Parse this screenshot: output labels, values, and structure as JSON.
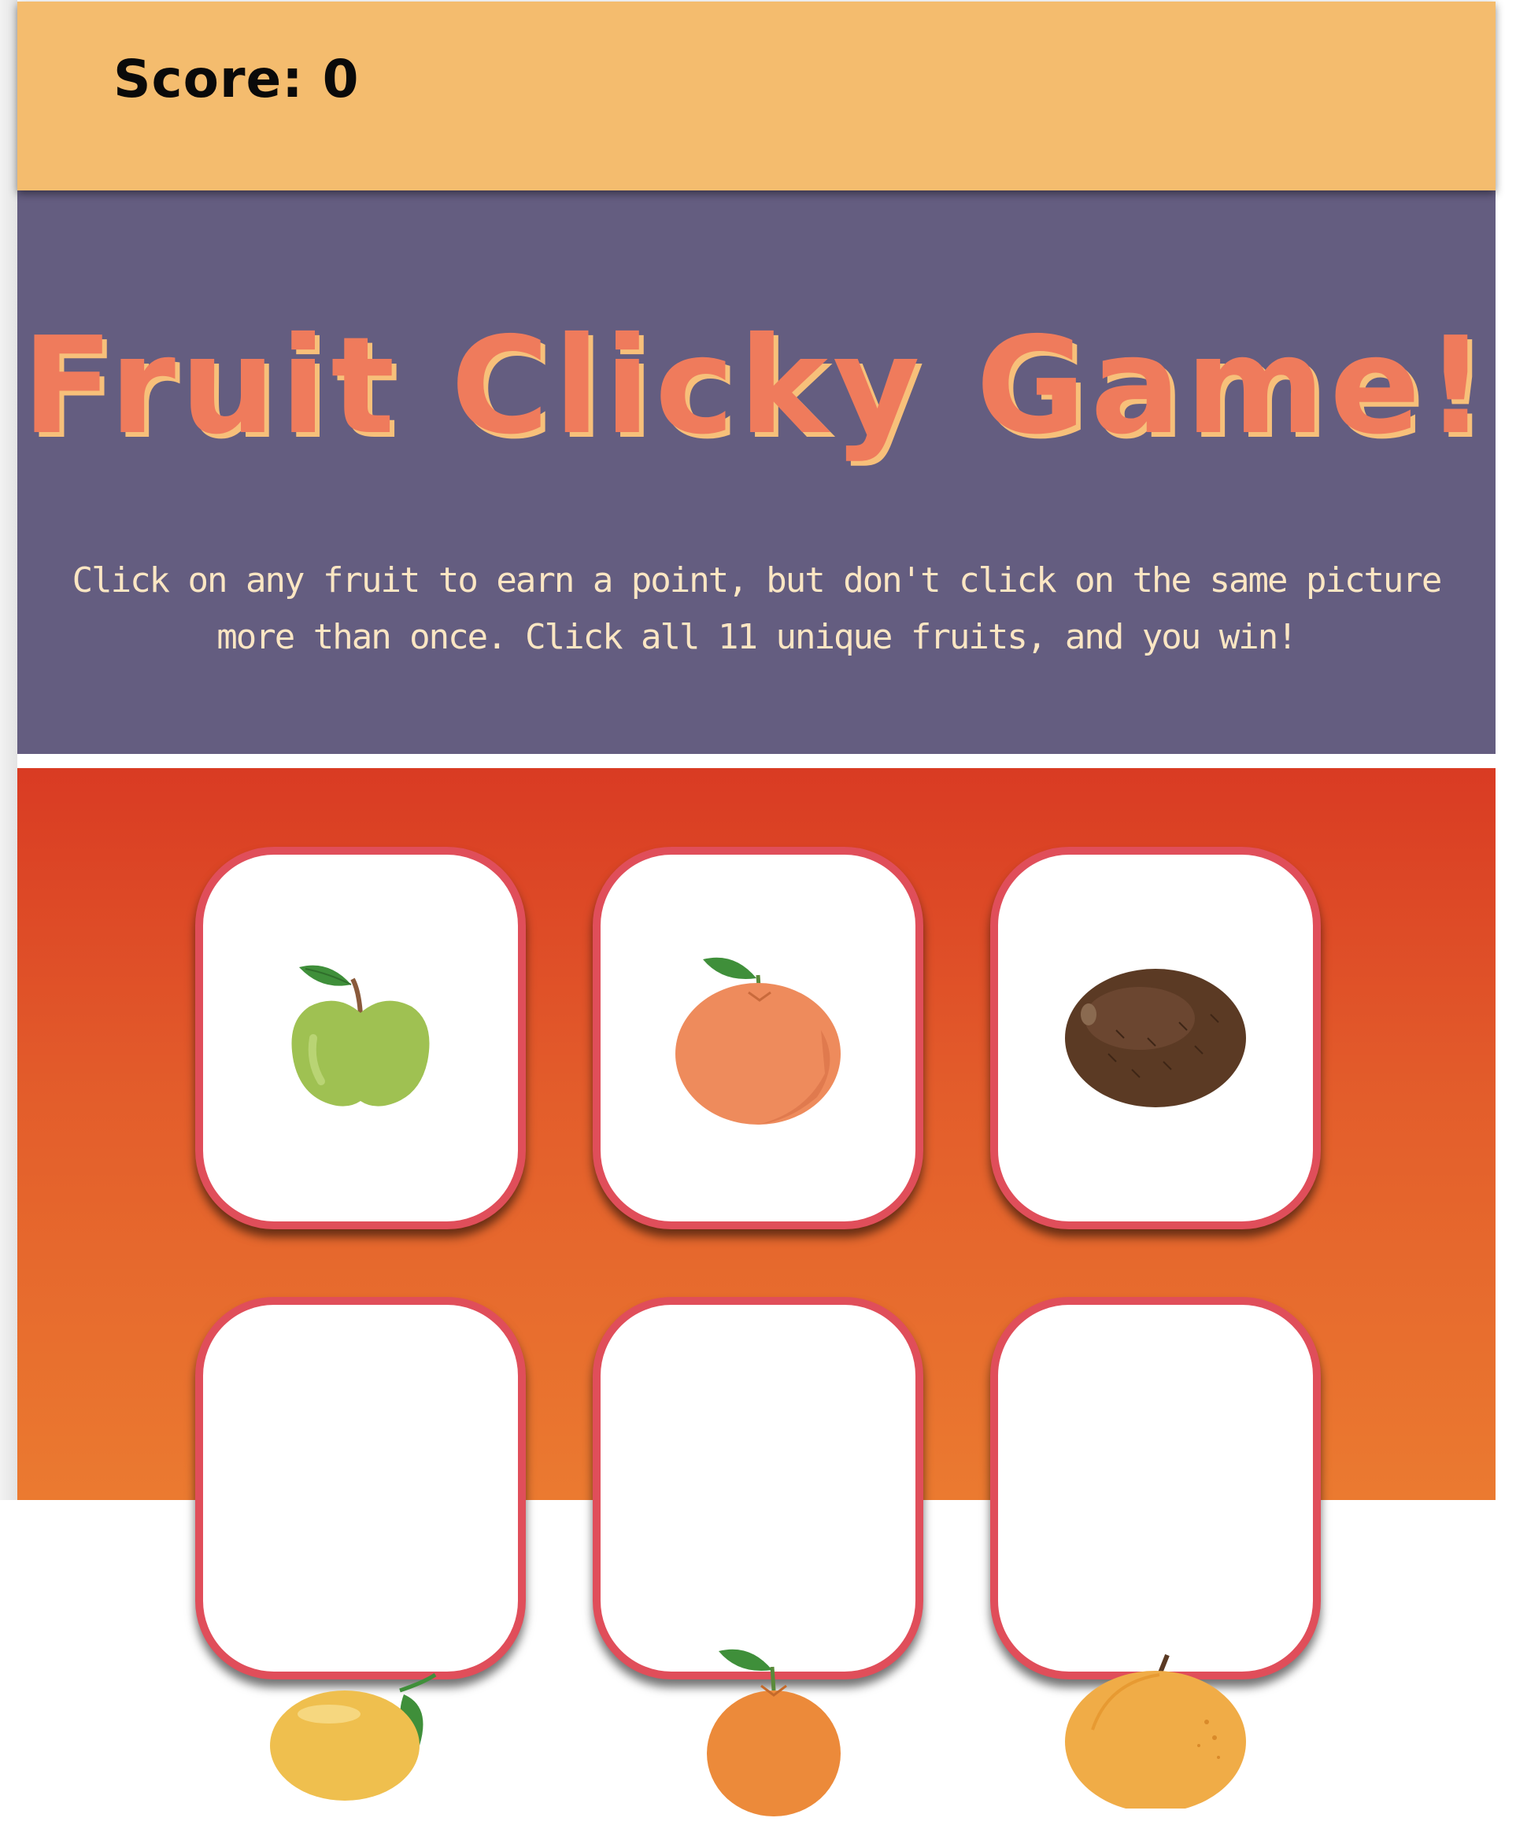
{
  "navbar": {
    "score_label": "Score: 0"
  },
  "header": {
    "title": "Fruit Clicky Game!",
    "instructions": "Click on any fruit to earn a point, but don't click on the same picture more than once. Click all 11 unique fruits, and you win!"
  },
  "cards": [
    {
      "fruit": "green-apple-icon"
    },
    {
      "fruit": "tangerine-icon"
    },
    {
      "fruit": "kiwi-icon"
    },
    {
      "fruit": "lemon-icon"
    },
    {
      "fruit": "orange-icon"
    },
    {
      "fruit": "apricot-icon"
    }
  ],
  "colors": {
    "navbar": "#f4bc6e",
    "jumbotron": "#645d80",
    "title": "#ef7b5c",
    "title_shadow": "#f7c07a",
    "instructions": "#fbe6c3",
    "board_top": "#d93b23",
    "board_bottom": "#eb7a30",
    "card_border": "#e04e5a"
  }
}
